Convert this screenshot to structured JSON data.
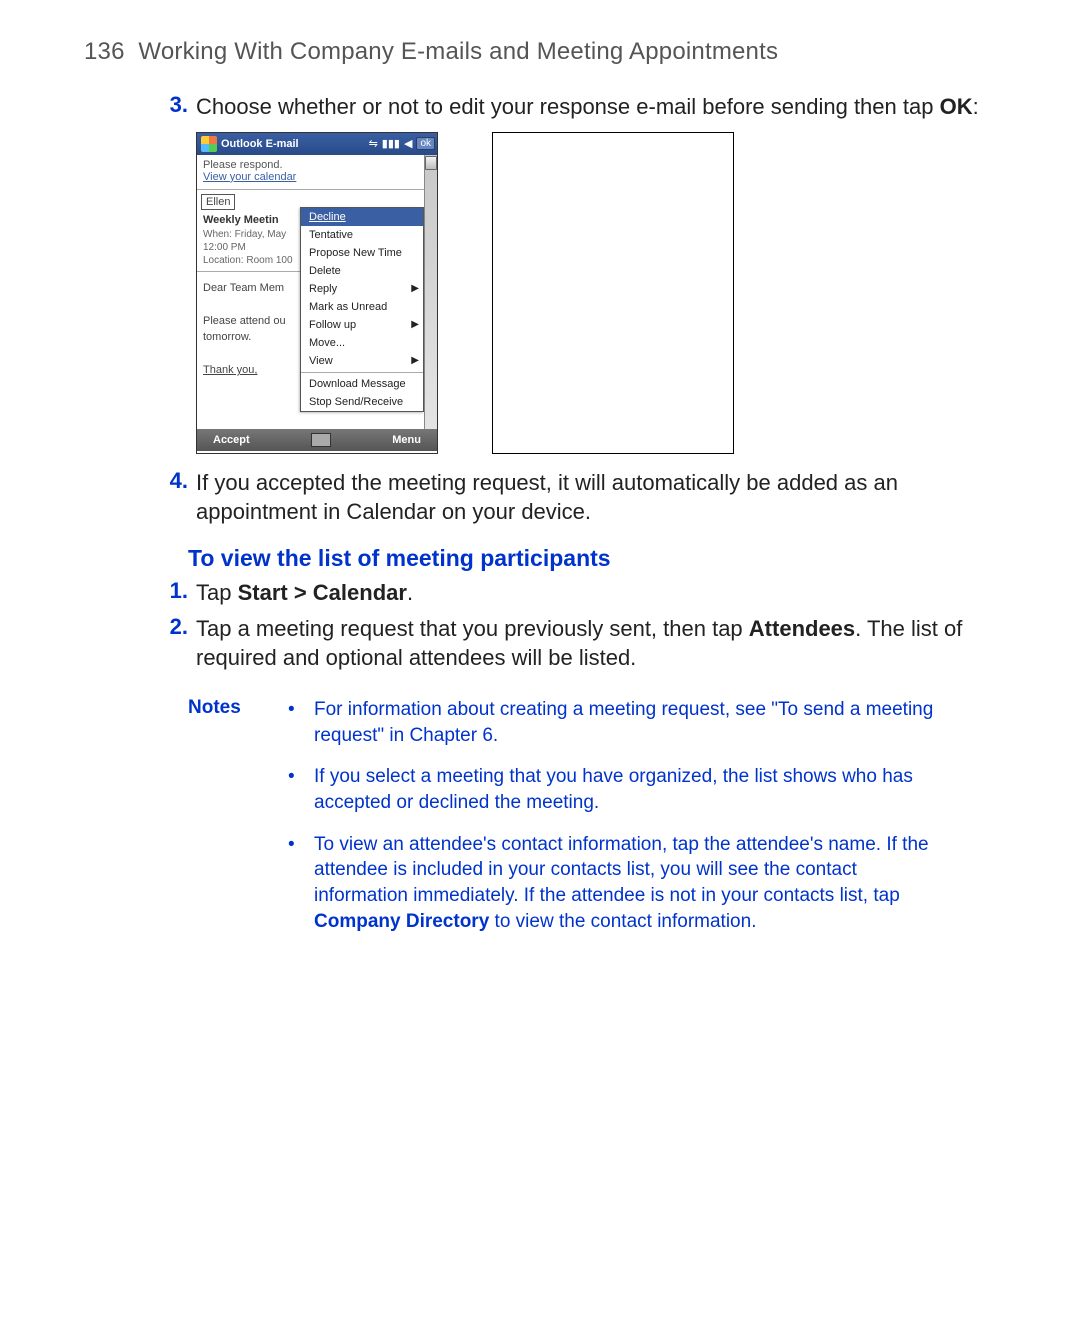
{
  "header": {
    "page_number": "136",
    "section_title": "Working With Company E-mails and Meeting Appointments"
  },
  "steps_a": [
    {
      "num": "3.",
      "pre": "Choose whether or not to edit your response e-mail before sending then tap ",
      "bold": "OK",
      "post": ":"
    },
    {
      "num": "4.",
      "pre": "If you accepted the meeting request, it will automatically be added as an appointment in Calendar on your device.",
      "bold": "",
      "post": ""
    }
  ],
  "sub_heading": "To view the list of meeting participants",
  "steps_b": [
    {
      "num": "1.",
      "pre": "Tap ",
      "bold": "Start > Calendar",
      "post": "."
    },
    {
      "num": "2.",
      "pre": "Tap a meeting request that you previously sent, then tap ",
      "bold": "Attendees",
      "post": ". The list of required and optional attendees will be listed."
    }
  ],
  "notes_label": "Notes",
  "notes": [
    {
      "text_a": "For information about creating a meeting request, see \"To send a meeting request\" in Chapter 6.",
      "bold": "",
      "text_b": ""
    },
    {
      "text_a": "If you select a meeting that you have organized, the list shows who has accepted or declined the meeting.",
      "bold": "",
      "text_b": ""
    },
    {
      "text_a": "To view an attendee's contact information, tap the attendee's name. If the attendee is included in your contacts list, you will see the contact information immediately. If the attendee is not in your contacts list, tap ",
      "bold": "Company Directory",
      "text_b": " to view the contact information."
    }
  ],
  "device": {
    "title": "Outlook E-mail",
    "ok": "ok",
    "please_respond": "Please respond.",
    "view_calendar": "View your calendar",
    "from": "Ellen",
    "subject": "Weekly Meetin",
    "when_label": "When: Friday, May",
    "when_time": "12:00 PM",
    "location": "Location: Room 100",
    "greeting": "Dear Team Mem",
    "line1": "Please attend ou",
    "line2": "tomorrow.",
    "thanks": "Thank you,",
    "accept": "Accept",
    "menu_btn": "Menu",
    "menu_items": [
      {
        "label": "Decline",
        "sel": true,
        "arrow": false
      },
      {
        "label": "Tentative",
        "sel": false,
        "arrow": false
      },
      {
        "label": "Propose New Time",
        "sel": false,
        "arrow": false
      },
      {
        "label": "Delete",
        "sel": false,
        "arrow": false
      },
      {
        "label": "Reply",
        "sel": false,
        "arrow": true
      },
      {
        "label": "Mark as Unread",
        "sel": false,
        "arrow": false
      },
      {
        "label": "Follow up",
        "sel": false,
        "arrow": true
      },
      {
        "label": "Move...",
        "sel": false,
        "arrow": false
      },
      {
        "label": "View",
        "sel": false,
        "arrow": true
      },
      {
        "label": "Download Message",
        "sel": false,
        "arrow": false,
        "hr_before": true
      },
      {
        "label": "Stop Send/Receive",
        "sel": false,
        "arrow": false
      }
    ]
  }
}
